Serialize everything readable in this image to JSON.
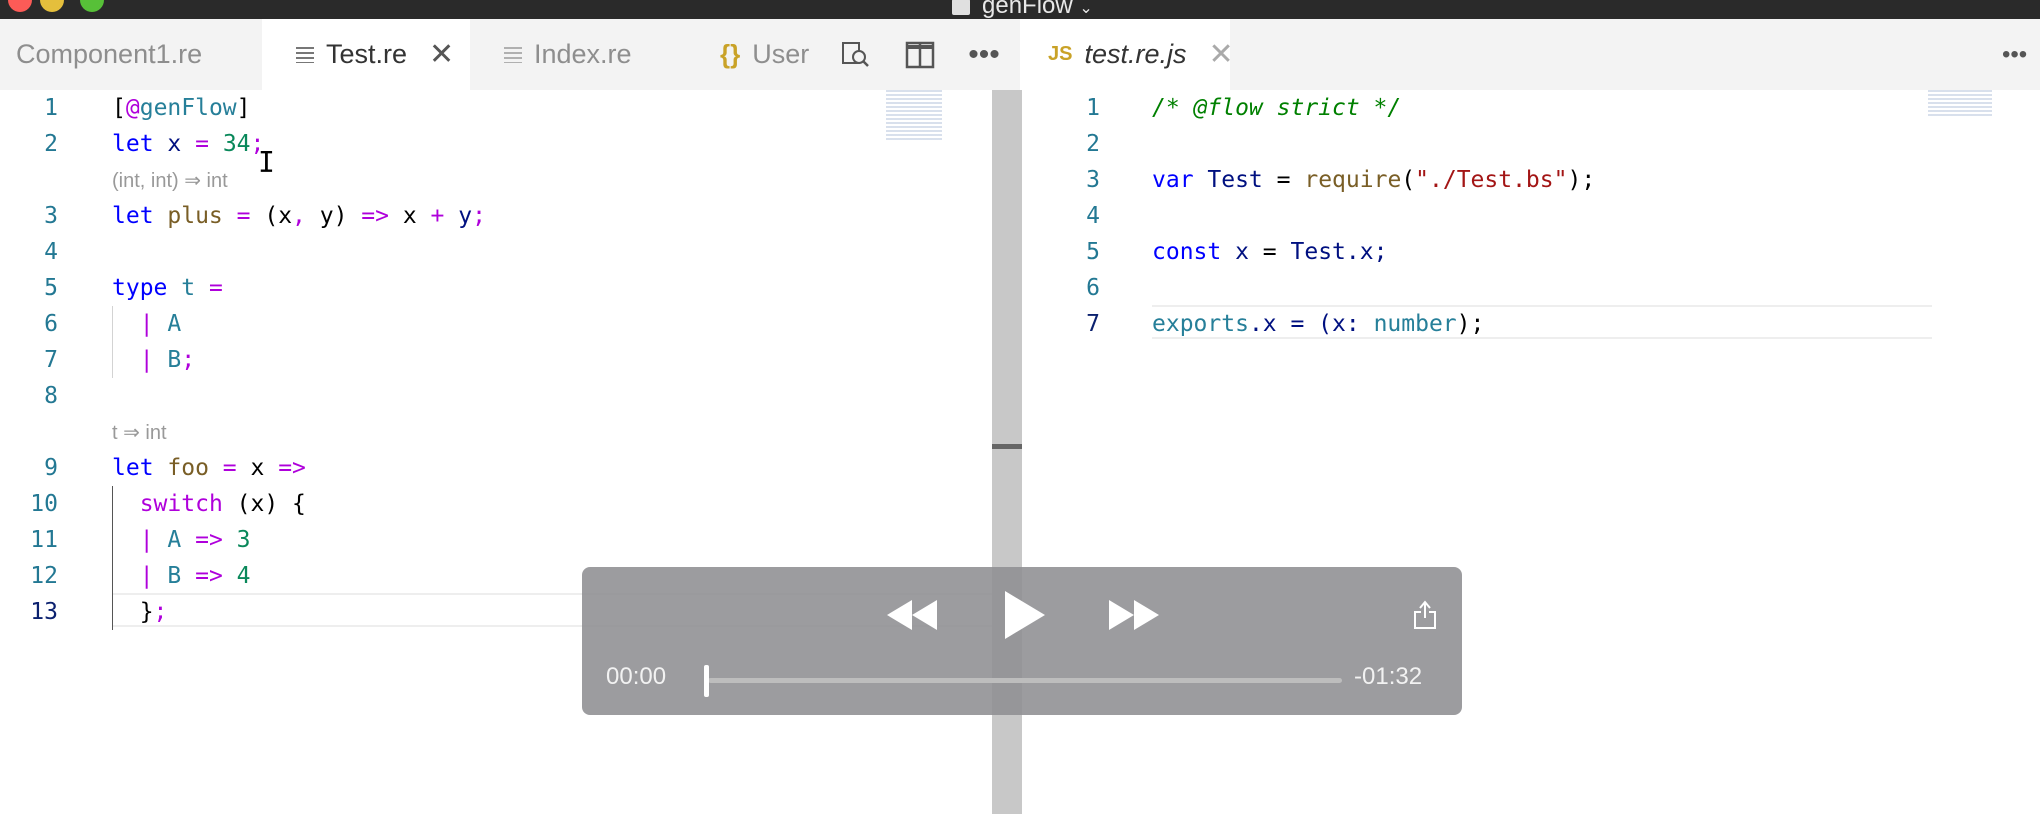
{
  "window": {
    "title": "genFlow"
  },
  "left_tabs": [
    {
      "label": "Component1.re",
      "icon": "file-lines-icon",
      "active": false
    },
    {
      "label": "Test.re",
      "icon": "file-lines-icon",
      "active": true
    },
    {
      "label": "Index.re",
      "icon": "file-lines-icon",
      "active": false
    },
    {
      "label": "User",
      "icon": "json-braces-icon",
      "active": false
    }
  ],
  "toolbar": {
    "find_icon": "search-in-files-icon",
    "split_icon": "split-editor-icon",
    "more_icon": "ellipsis-icon"
  },
  "right_tabs": [
    {
      "label": "test.re.js",
      "badge": "JS",
      "active": true
    }
  ],
  "left_editor": {
    "line_numbers": [
      "1",
      "2",
      "3",
      "4",
      "5",
      "6",
      "7",
      "8",
      "9",
      "10",
      "11",
      "12",
      "13"
    ],
    "hints": [
      "(int, int) ⇒ int",
      "t ⇒ int"
    ],
    "lines": {
      "l1": [
        "[",
        "@",
        "genFlow",
        "]"
      ],
      "l2": [
        "let",
        " x ",
        "=",
        " ",
        "34",
        ";"
      ],
      "l3": [
        "let",
        " plus ",
        "=",
        " (x",
        ",",
        " y) ",
        "=>",
        " x ",
        "+",
        " y",
        ";"
      ],
      "l5": [
        "type",
        " t ",
        "="
      ],
      "l6": [
        "  ",
        "|",
        " A"
      ],
      "l7": [
        "  ",
        "|",
        " B",
        ";"
      ],
      "l9": [
        "let",
        " foo ",
        "=",
        " x ",
        "=>"
      ],
      "l10": [
        "  ",
        "switch",
        " (x) {"
      ],
      "l11": [
        "  ",
        "|",
        " A ",
        "=>",
        " ",
        "3"
      ],
      "l12": [
        "  ",
        "|",
        " B ",
        "=>",
        " ",
        "4"
      ],
      "l13": [
        "  }",
        ";"
      ]
    }
  },
  "right_editor": {
    "line_numbers": [
      "1",
      "2",
      "3",
      "4",
      "5",
      "6",
      "7"
    ],
    "lines": {
      "l1": "/* @flow strict */",
      "l3": [
        "var",
        " Test ",
        "=",
        " ",
        "require",
        "(",
        "\"./Test.bs\"",
        ");"
      ],
      "l5": [
        "const",
        " x ",
        "=",
        " Test.x;"
      ],
      "l7": [
        "exports",
        ".x = (x: ",
        "number",
        ");"
      ]
    }
  },
  "player": {
    "current_time": "00:00",
    "remaining_time": "-01:32",
    "progress": 0,
    "rewind_icon": "rewind-icon",
    "play_icon": "play-icon",
    "forward_icon": "fast-forward-icon",
    "share_icon": "share-icon"
  }
}
